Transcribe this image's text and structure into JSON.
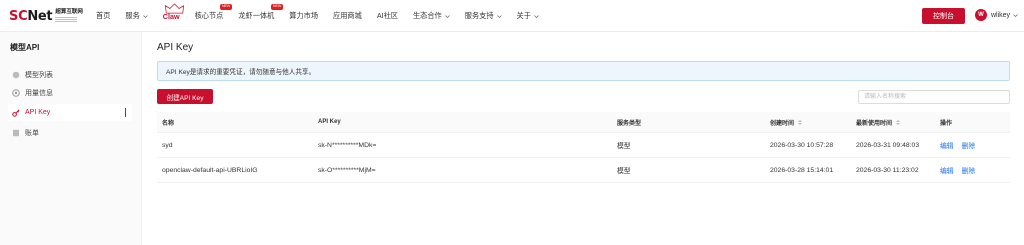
{
  "header": {
    "logo": {
      "brand_prefix": "SC",
      "brand_suffix": "Net",
      "tagline": "超算互联网"
    },
    "nav": [
      {
        "label": "首页",
        "chevron": false
      },
      {
        "label": "服务",
        "chevron": true
      },
      {
        "label": "Claw",
        "chevron": false
      },
      {
        "label": "核心节点",
        "chevron": false,
        "badge": "NEW"
      },
      {
        "label": "龙虾一体机",
        "chevron": false,
        "badge": "NEW"
      },
      {
        "label": "算力市场",
        "chevron": false
      },
      {
        "label": "应用商城",
        "chevron": false
      },
      {
        "label": "AI社区",
        "chevron": false
      },
      {
        "label": "生态合作",
        "chevron": true
      },
      {
        "label": "服务支持",
        "chevron": true
      },
      {
        "label": "关于",
        "chevron": true
      }
    ],
    "console_button": "控制台",
    "user": {
      "avatar_letter": "W",
      "name": "wlikey"
    }
  },
  "sidebar": {
    "title": "模型API",
    "items": [
      {
        "label": "模型列表",
        "icon": "model-list-icon",
        "active": false
      },
      {
        "label": "用量信息",
        "icon": "usage-icon",
        "active": false
      },
      {
        "label": "API Key",
        "icon": "key-icon",
        "active": true
      },
      {
        "label": "账单",
        "icon": "bill-icon",
        "active": false
      }
    ]
  },
  "main": {
    "title": "API Key",
    "notice": "API Key是请求的重要凭证，请勿随意与他人共享。",
    "create_button": "创建API Key",
    "search_placeholder": "请输入名称搜索",
    "table": {
      "headers": {
        "name": "名称",
        "key": "API Key",
        "type": "服务类型",
        "created": "创建时间",
        "last_used": "最新使用时间",
        "ops": "操作"
      },
      "rows": [
        {
          "name": "syd",
          "key": "sk-N**********MDk=",
          "type": "模型",
          "created": "2026-03-30 10:57:28",
          "last_used": "2026-03-31 09:48:03",
          "edit": "编辑",
          "delete": "删除"
        },
        {
          "name": "openclaw-default-api-UBRLioIG",
          "key": "sk-O**********MjM=",
          "type": "模型",
          "created": "2026-03-28 15:14:01",
          "last_used": "2026-03-30 11:23:02",
          "edit": "编辑",
          "delete": "删除"
        }
      ]
    }
  },
  "colors": {
    "brand_red": "#c8102e",
    "link_blue": "#1a73e8",
    "notice_bg": "#eef6fd",
    "notice_border": "#bcdcf7"
  }
}
